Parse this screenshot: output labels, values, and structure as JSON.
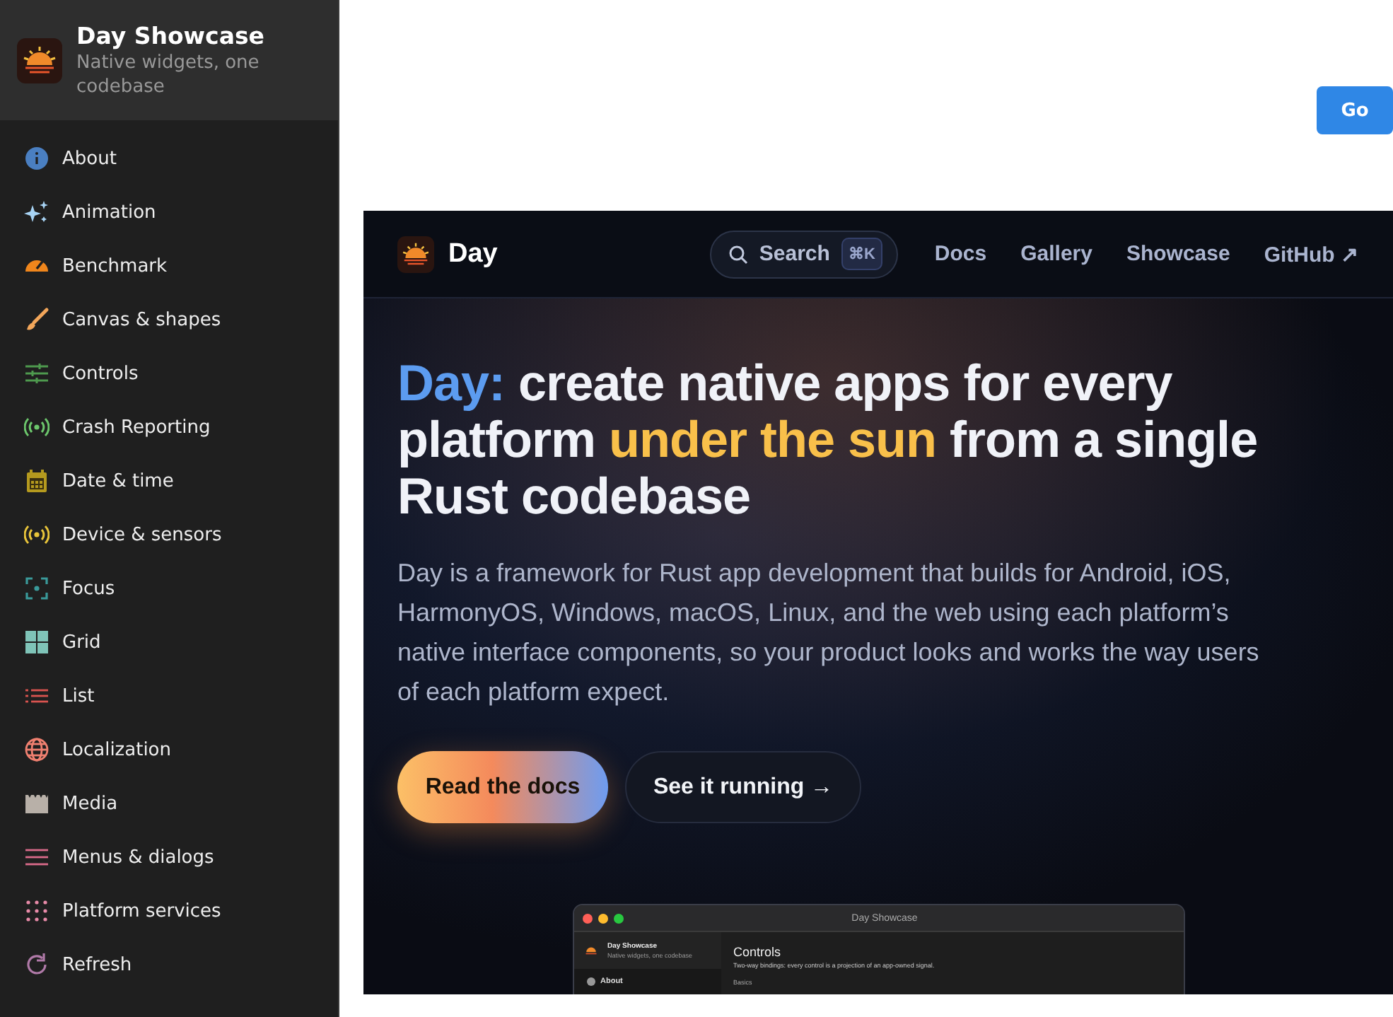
{
  "sidebar": {
    "app_title": "Day Showcase",
    "app_subtitle": "Native widgets, one codebase",
    "items": [
      {
        "label": "About",
        "color": "#4a7fc1"
      },
      {
        "label": "Animation",
        "color": "#a8d4f5"
      },
      {
        "label": "Benchmark",
        "color": "#f0861c"
      },
      {
        "label": "Canvas & shapes",
        "color": "#f2a65a"
      },
      {
        "label": "Controls",
        "color": "#4e9a4e"
      },
      {
        "label": "Crash Reporting",
        "color": "#6cc76c"
      },
      {
        "label": "Date & time",
        "color": "#b59a1e"
      },
      {
        "label": "Device & sensors",
        "color": "#e8c43a"
      },
      {
        "label": "Focus",
        "color": "#3a9a9a"
      },
      {
        "label": "Grid",
        "color": "#7fc4b8"
      },
      {
        "label": "List",
        "color": "#d9534f"
      },
      {
        "label": "Localization",
        "color": "#f08070"
      },
      {
        "label": "Media",
        "color": "#b8b0a8"
      },
      {
        "label": "Menus & dialogs",
        "color": "#d96a8a"
      },
      {
        "label": "Platform services",
        "color": "#e88aa8"
      },
      {
        "label": "Refresh",
        "color": "#b07aa8"
      }
    ]
  },
  "go_button": "Go",
  "site": {
    "brand": "Day",
    "search": {
      "label": "Search",
      "shortcut": "⌘K"
    },
    "nav_links": [
      "Docs",
      "Gallery",
      "Showcase",
      "GitHub ↗"
    ],
    "headline": [
      {
        "text": "Day:",
        "kind": "blue"
      },
      {
        "text": " create native apps for every platform ",
        "kind": "plain"
      },
      {
        "text": "under the sun",
        "kind": "gold"
      },
      {
        "text": " from a single Rust codebase",
        "kind": "plain"
      }
    ],
    "description": "Day is a framework for Rust app development that builds for Android, iOS, HarmonyOS, Windows, macOS, Linux, and the web using each platform’s native interface components, so your product looks and works the way users of each platform expect.",
    "primary_button": "Read the docs",
    "secondary_button": "See it running →",
    "preview": {
      "window_title": "Day Showcase",
      "app_title": "Day Showcase",
      "app_subtitle": "Native widgets, one codebase",
      "sidebar_item": "About",
      "heading": "Controls",
      "description": "Two-way bindings: every control is a projection of an app-owned signal.",
      "section": "Basics"
    }
  }
}
